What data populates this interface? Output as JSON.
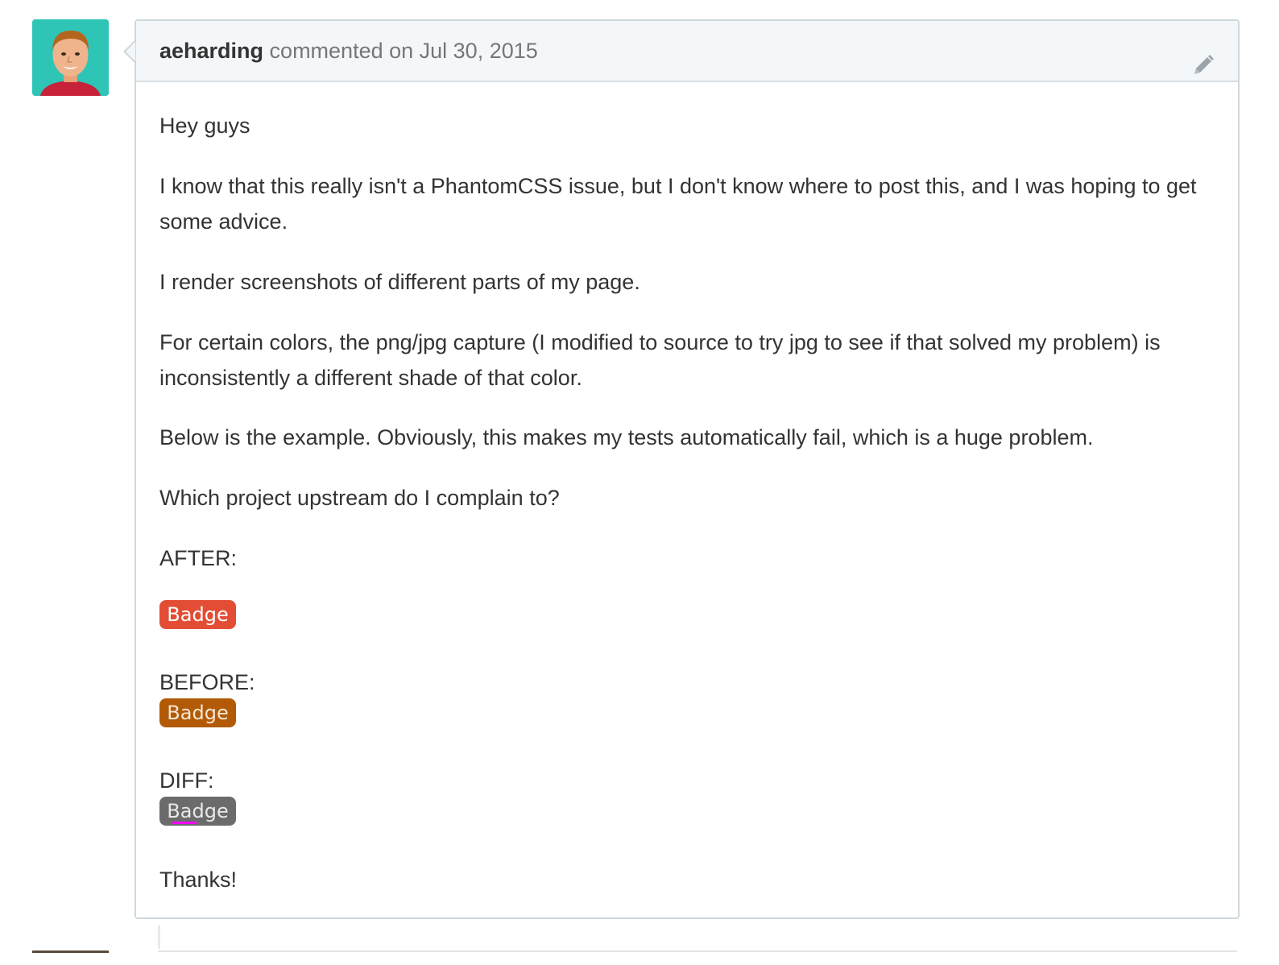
{
  "comment": {
    "author": "aeharding",
    "action": "commented on Jul 30, 2015",
    "paragraphs": {
      "p1": "Hey guys",
      "p2": "I know that this really isn't a PhantomCSS issue, but I don't know where to post this, and I was hoping to get some advice.",
      "p3": "I render screenshots of different parts of my page.",
      "p4": "For certain colors, the png/jpg capture (I modified to source to try jpg to see if that solved my problem) is inconsistently a different shade of that color.",
      "p5": "Below is the example. Obviously, this makes my tests automatically fail, which is a huge problem.",
      "p6": "Which project upstream do I complain to?",
      "after_label": "AFTER:",
      "before_label": "BEFORE:",
      "diff_label": "DIFF:",
      "thanks": "Thanks!"
    },
    "badges": {
      "after": "Badge",
      "before": "Badge",
      "diff": "Badge"
    }
  },
  "icons": {
    "edit": "pencil-icon",
    "avatar": "user-avatar"
  },
  "colors": {
    "badge_after": "#e34d35",
    "badge_before": "#b25a06",
    "badge_diff": "#6b6b6b",
    "avatar_bg": "#2ec4b6"
  }
}
